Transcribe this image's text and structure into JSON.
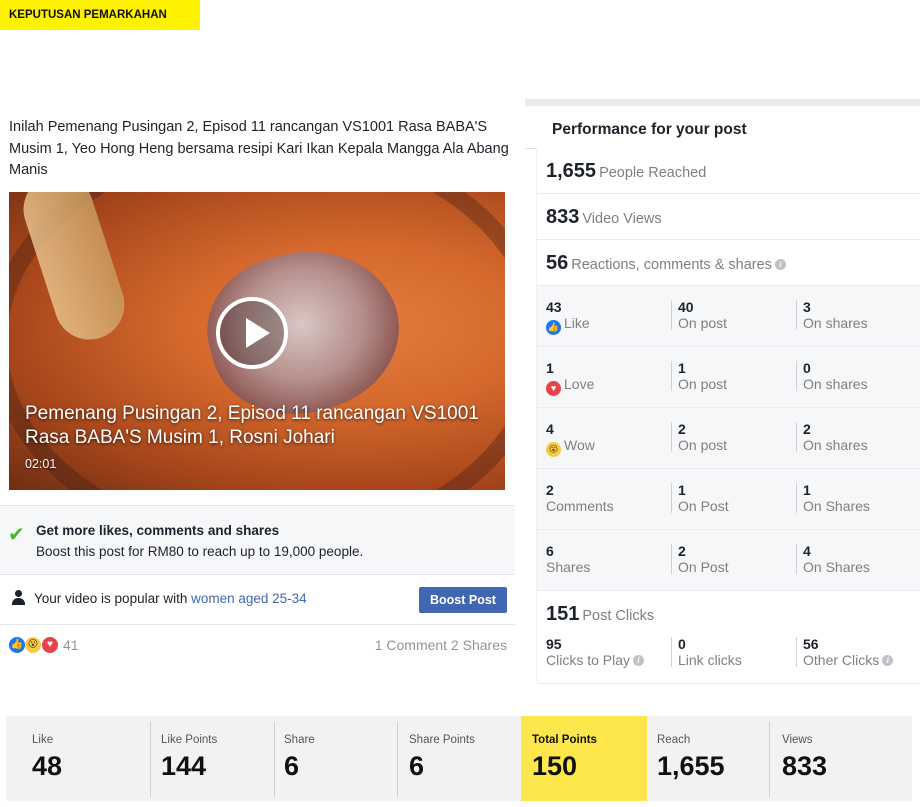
{
  "banner": "KEPUTUSAN PEMARKAHAN",
  "post": {
    "text": "Inilah Pemenang Pusingan 2, Episod 11 rancangan VS1001 Rasa BABA'S Musim 1, Yeo Hong Heng bersama resipi Kari Ikan Kepala Mangga Ala Abang Manis",
    "video_title": "Pemenang Pusingan 2, Episod 11 rancangan VS1001 Rasa BABA'S Musim 1, Rosni Johari",
    "video_duration": "02:01",
    "boost_title": "Get more likes, comments and shares",
    "boost_desc": "Boost this post for RM80 to reach up to 19,000 people.",
    "popular_prefix": "Your video is popular with ",
    "popular_link": "women aged 25-34",
    "boost_button": "Boost Post",
    "reaction_count": "41",
    "comments_shares": "1 Comment  2 Shares"
  },
  "performance": {
    "title": "Performance for your post",
    "reached": {
      "num": "1,655",
      "label": "People Reached"
    },
    "views": {
      "num": "833",
      "label": "Video Views"
    },
    "reactions": {
      "num": "56",
      "label": "Reactions, comments & shares"
    },
    "rows": [
      {
        "icon": "like",
        "c1n": "43",
        "c1l": "Like",
        "c2n": "40",
        "c2l": "On post",
        "c3n": "3",
        "c3l": "On shares"
      },
      {
        "icon": "love",
        "c1n": "1",
        "c1l": "Love",
        "c2n": "1",
        "c2l": "On post",
        "c3n": "0",
        "c3l": "On shares"
      },
      {
        "icon": "wow",
        "c1n": "4",
        "c1l": "Wow",
        "c2n": "2",
        "c2l": "On post",
        "c3n": "2",
        "c3l": "On shares"
      },
      {
        "icon": "",
        "c1n": "2",
        "c1l": "Comments",
        "c2n": "1",
        "c2l": "On Post",
        "c3n": "1",
        "c3l": "On Shares"
      },
      {
        "icon": "",
        "c1n": "6",
        "c1l": "Shares",
        "c2n": "2",
        "c2l": "On Post",
        "c3n": "4",
        "c3l": "On Shares"
      }
    ],
    "clicks": {
      "num": "151",
      "label": "Post Clicks"
    },
    "clicks_row": {
      "c1n": "95",
      "c1l": "Clicks to Play",
      "c2n": "0",
      "c2l": "Link clicks",
      "c3n": "56",
      "c3l": "Other Clicks"
    }
  },
  "stats": [
    {
      "label": "Like",
      "value": "48"
    },
    {
      "label": "Like Points",
      "value": "144"
    },
    {
      "label": "Share",
      "value": "6"
    },
    {
      "label": "Share Points",
      "value": "6"
    },
    {
      "label": "Total Points",
      "value": "150"
    },
    {
      "label": "Reach",
      "value": "1,655"
    },
    {
      "label": "Views",
      "value": "833"
    }
  ],
  "colors": {
    "highlight": "#fde74c",
    "banner": "#fff200",
    "facebook_blue": "#4267b2"
  }
}
